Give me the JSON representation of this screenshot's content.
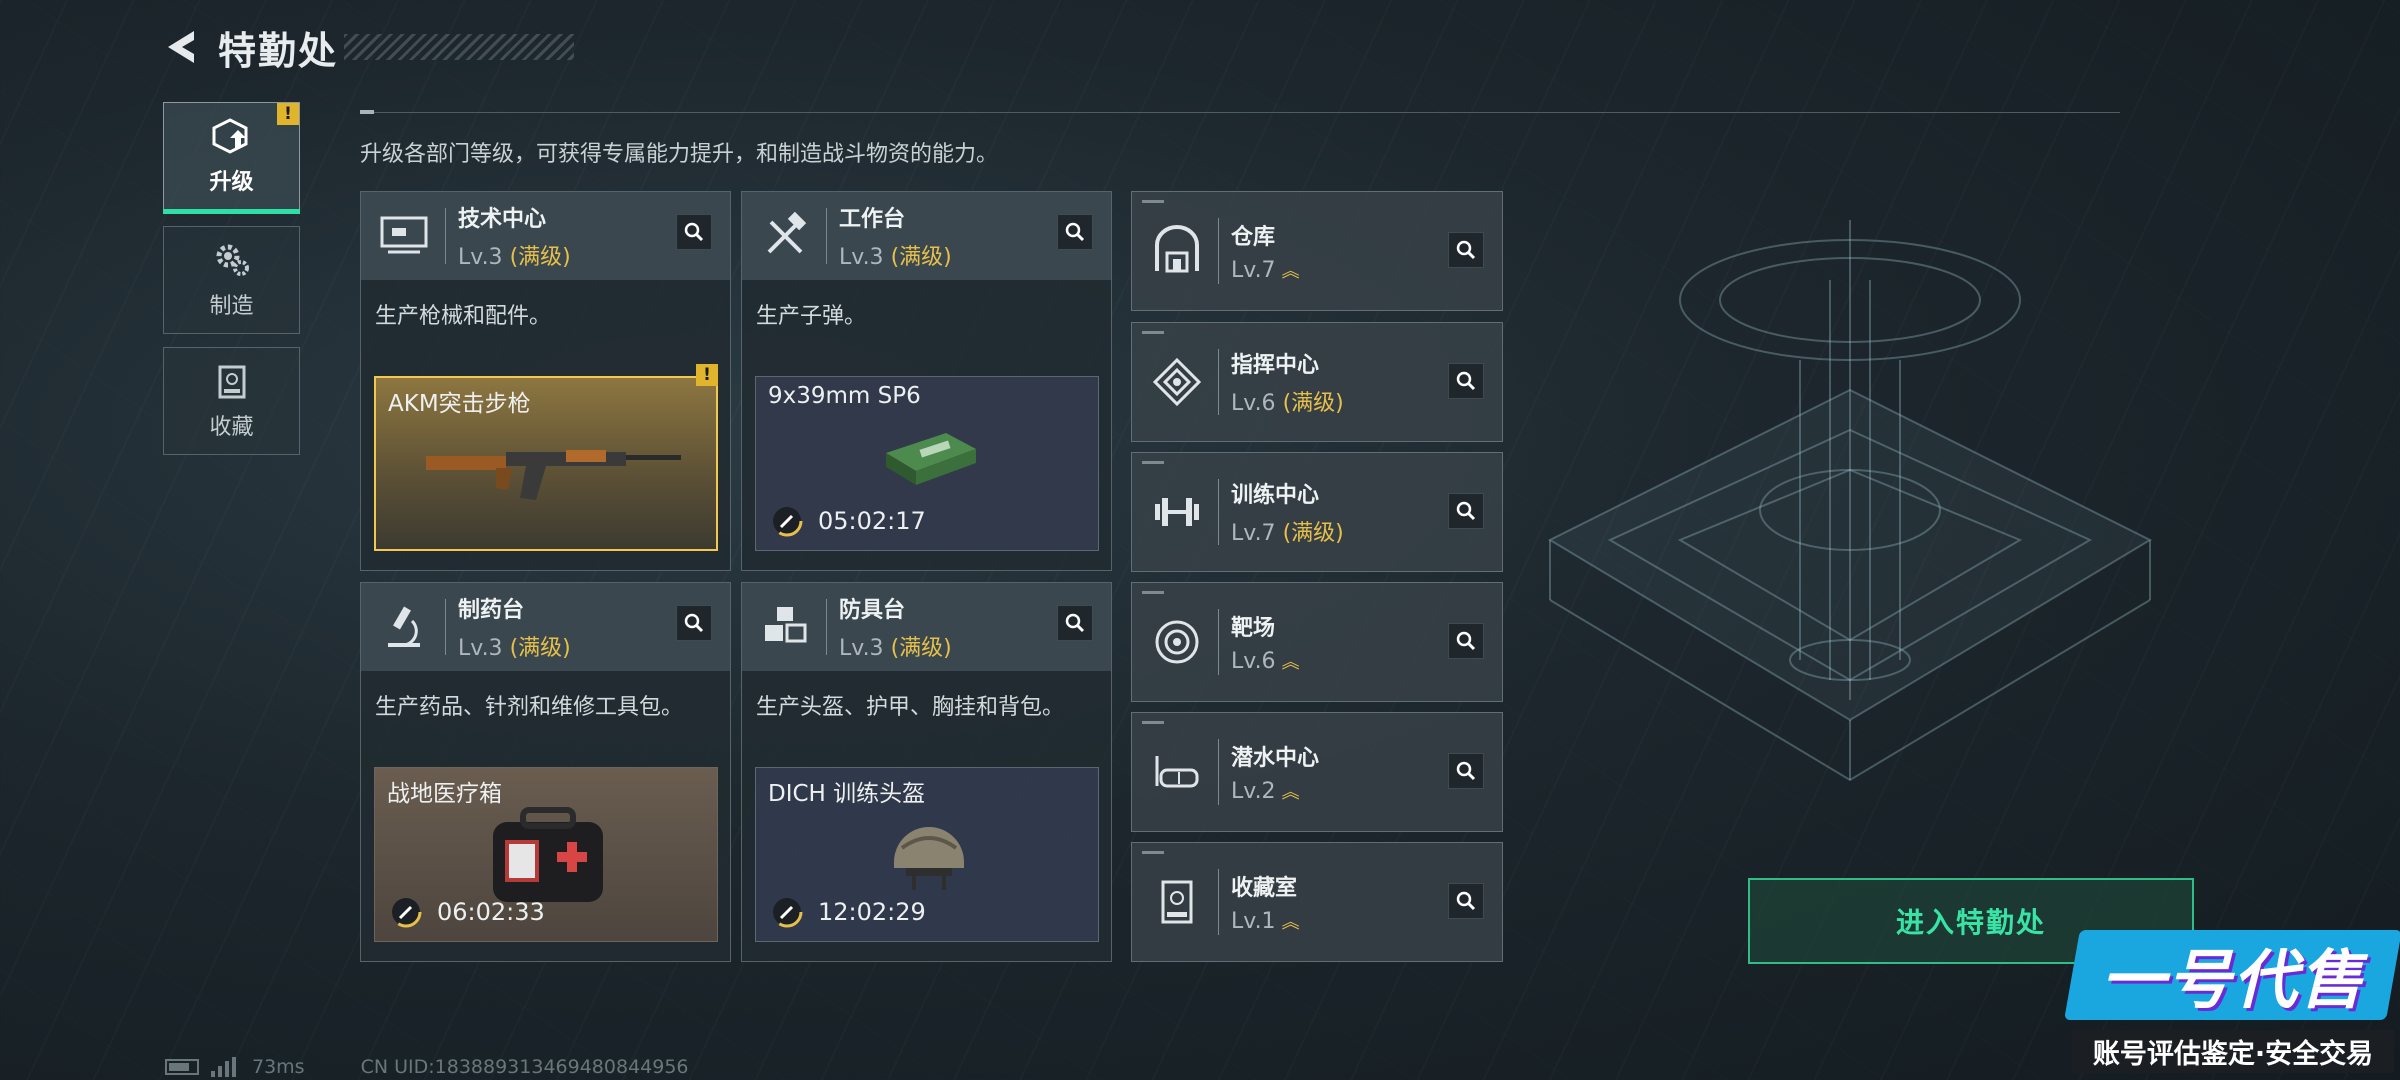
{
  "header": {
    "title": "特勤处"
  },
  "tabs": [
    {
      "label": "升级",
      "icon": "upgrade-icon",
      "active": true,
      "alert": "!"
    },
    {
      "label": "制造",
      "icon": "gears-icon",
      "active": false
    },
    {
      "label": "收藏",
      "icon": "collection-icon",
      "active": false
    }
  ],
  "description": "升级各部门等级，可获得专属能力提升，和制造战斗物资的能力。",
  "big_cards": [
    {
      "name": "技术中心",
      "level": "Lv.3",
      "max": "(满级)",
      "icon": "monitor-icon",
      "desc": "生产枪械和配件。",
      "product": {
        "name": "AKM突击步枪",
        "timer": "",
        "alert": "!",
        "style": "gold"
      }
    },
    {
      "name": "工作台",
      "level": "Lv.3",
      "max": "(满级)",
      "icon": "tools-icon",
      "desc": "生产子弹。",
      "product": {
        "name": "9x39mm SP6",
        "timer": "05:02:17",
        "style": "blue"
      }
    },
    {
      "name": "制药台",
      "level": "Lv.3",
      "max": "(满级)",
      "icon": "microscope-icon",
      "desc": "生产药品、针剂和维修工具包。",
      "product": {
        "name": "战地医疗箱",
        "timer": "06:02:33",
        "style": "brown"
      }
    },
    {
      "name": "防具台",
      "level": "Lv.3",
      "max": "(满级)",
      "icon": "boxes-icon",
      "desc": "生产头盔、护甲、胸挂和背包。",
      "product": {
        "name": "DICH 训练头盔",
        "timer": "12:02:29",
        "style": "blue"
      }
    }
  ],
  "small_cards": [
    {
      "name": "仓库",
      "level": "Lv.7",
      "max": "",
      "icon": "warehouse-icon",
      "upgrade": true
    },
    {
      "name": "指挥中心",
      "level": "Lv.6",
      "max": "(满级)",
      "icon": "command-icon",
      "upgrade": false
    },
    {
      "name": "训练中心",
      "level": "Lv.7",
      "max": "(满级)",
      "icon": "dumbbell-icon",
      "upgrade": false
    },
    {
      "name": "靶场",
      "level": "Lv.6",
      "max": "",
      "icon": "target-icon",
      "upgrade": true
    },
    {
      "name": "潜水中心",
      "level": "Lv.2",
      "max": "",
      "icon": "goggles-icon",
      "upgrade": true
    },
    {
      "name": "收藏室",
      "level": "Lv.1",
      "max": "",
      "icon": "display-case-icon",
      "upgrade": true
    }
  ],
  "enter_button": "进入特勤处",
  "status": {
    "ping": "73ms",
    "uid": "CN UID:1838893134694808449​56"
  },
  "watermark": {
    "title": "一号代售",
    "subtitle": "账号评估鉴定·安全交易"
  },
  "colors": {
    "accent": "#2fe0a6",
    "gold": "#e7c04a",
    "alert": "#e1b52b"
  }
}
